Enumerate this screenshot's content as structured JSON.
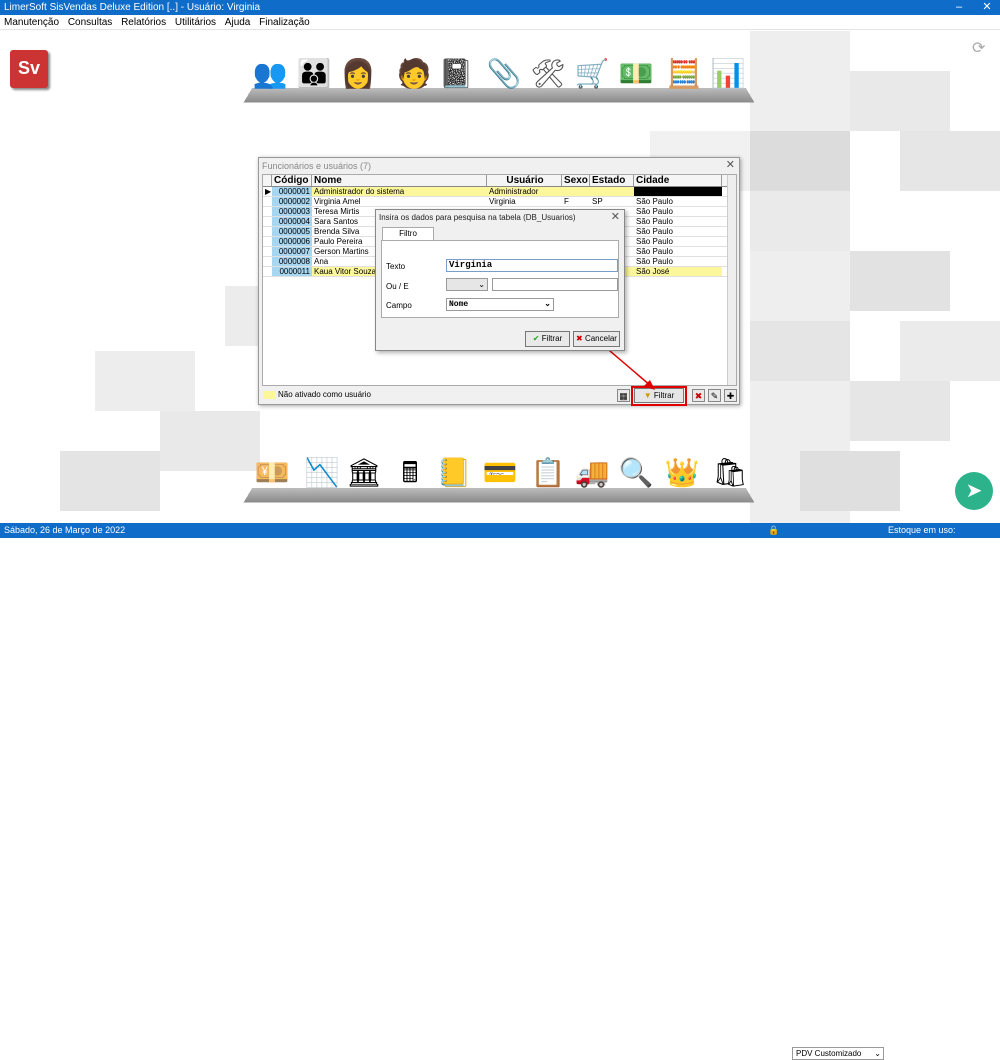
{
  "app": {
    "title": "LimerSoft SisVendas Deluxe Edition [..] - Usuário: Virginia",
    "minimize": "–",
    "close": "✕"
  },
  "menu": [
    "Manutenção",
    "Consultas",
    "Relatórios",
    "Utilitários",
    "Ajuda",
    "Finalização"
  ],
  "logo": "Sv",
  "status": {
    "date": "Sábado, 26 de Março de 2022",
    "pdv": "PDV Customizado",
    "estoque": "Estoque em uso: DB_Estoque"
  },
  "dialog_users": {
    "title": "Funcionários e usuários (7)",
    "columns": [
      "Código",
      "Nome",
      "Usuário",
      "Sexo",
      "Estado",
      "Cidade"
    ],
    "rows": [
      [
        "0000001",
        "Administrador do sistema",
        "Administrador",
        "",
        "",
        ""
      ],
      [
        "0000002",
        "Virginia Amel",
        "Virginia",
        "F",
        "SP",
        "São Paulo"
      ],
      [
        "0000003",
        "Teresa Mirtis",
        "",
        "",
        "",
        "São Paulo"
      ],
      [
        "0000004",
        "Sara Santos",
        "",
        "",
        "",
        "São Paulo"
      ],
      [
        "0000005",
        "Brenda Silva",
        "",
        "",
        "",
        "São Paulo"
      ],
      [
        "0000006",
        "Paulo Pereira",
        "",
        "",
        "",
        "São Paulo"
      ],
      [
        "0000007",
        "Gerson Martins",
        "",
        "",
        "",
        "São Paulo"
      ],
      [
        "0000008",
        "Ana",
        "",
        "",
        "",
        "São Paulo"
      ],
      [
        "0000011",
        "Kaua Vitor Souza",
        "",
        "",
        "",
        "São José"
      ]
    ],
    "legend": "Não ativado como usuário",
    "filter_button": "Filtrar"
  },
  "dialog_search": {
    "title": "Insira os dados para pesquisa na tabela (DB_Usuarios)",
    "tab": "Filtro avançado",
    "texto_label": "Texto",
    "texto_value": "Virginia",
    "oue_label": "Ou / E",
    "campo_label": "Campo",
    "campo_value": "Nome",
    "filtrar": "Filtrar",
    "cancelar": "Cancelar"
  },
  "colors": {
    "accent": "#0f6cc8",
    "highlight_row": "#fcf79b",
    "code_col": "#a7d6f0",
    "annotation": "#e00000"
  },
  "icons_top": [
    "users-group-icon",
    "users-team-icon",
    "users-women-icon",
    "employee-icon",
    "notebook-icon",
    "stapler-icon",
    "tools-icon",
    "shopping-cart-icon",
    "money-icon",
    "calculator-icon",
    "bar-chart-icon"
  ],
  "icons_bottom": [
    "cash-icon",
    "sales-chart-icon",
    "bank-icon",
    "cash-register-icon",
    "ledger-icon",
    "payment-icon",
    "clipboard-icon",
    "truck-icon",
    "magnifier-icon",
    "crown-icon",
    "shopping-bag-icon"
  ]
}
